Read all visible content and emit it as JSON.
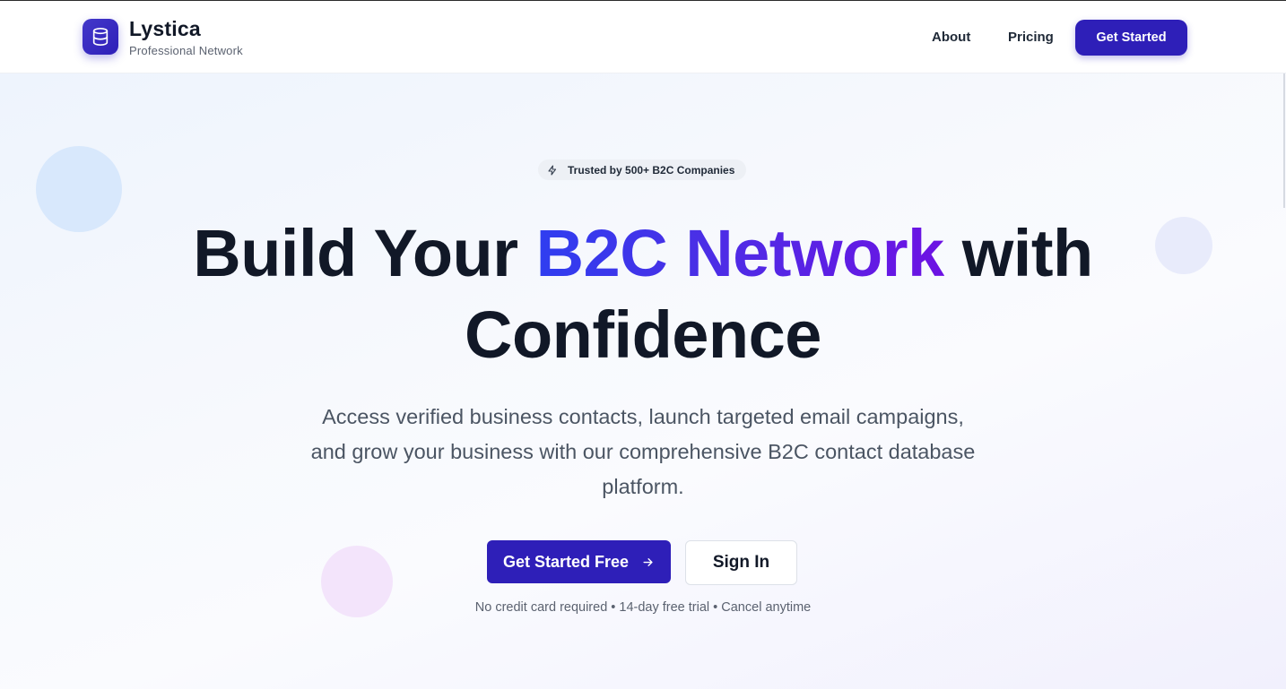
{
  "header": {
    "brand_name": "Lystica",
    "brand_sub": "Professional Network",
    "logo_icon": "database-icon",
    "nav": {
      "about": "About",
      "pricing": "Pricing",
      "cta": "Get Started"
    }
  },
  "hero": {
    "badge_icon": "lightning-icon",
    "badge_text": "Trusted by 500+ B2C Companies",
    "headline_part1": "Build Your ",
    "headline_highlight": "B2C Network",
    "headline_part2": " with",
    "headline_line2": "Confidence",
    "subtext": "Access verified business contacts, launch targeted email campaigns, and grow your business with our comprehensive B2C contact database platform.",
    "primary_button": "Get Started Free",
    "primary_button_icon": "arrow-right-icon",
    "secondary_button": "Sign In",
    "fineprint": "No credit card required • 14-day free trial • Cancel anytime"
  },
  "colors": {
    "brand": "#2e1fb8",
    "gradient_start": "#2f3ef0",
    "gradient_end": "#6d12e3",
    "text_dark": "#111827",
    "text_muted": "#4b5563"
  }
}
